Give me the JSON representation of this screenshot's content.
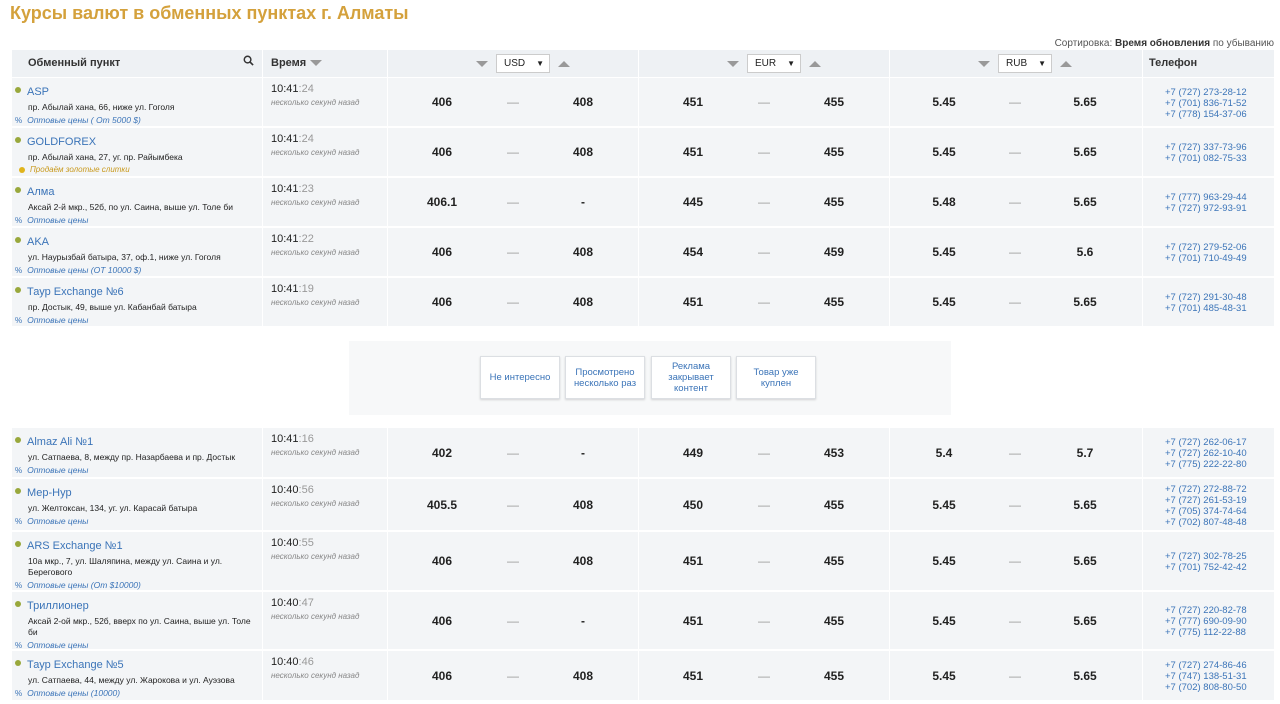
{
  "page_title": "Курсы валют в обменных пунктах г. Алматы",
  "sort": {
    "prefix": "Сортировка:",
    "field": "Время обновления",
    "order": "по убыванию"
  },
  "header": {
    "name_label": "Обменный пункт",
    "time_label": "Время",
    "currencies": [
      "USD",
      "EUR",
      "RUB"
    ],
    "phone_label": "Телефон"
  },
  "rows_top": [
    {
      "name": "ASP",
      "addr": "пр. Абылай хана, 66, ниже ул. Гоголя",
      "whole": "Оптовые цены ( От 5000 $)",
      "time": "10:41",
      "sec": ":24",
      "ago": "несколько секунд назад",
      "usd_buy": "406",
      "usd_sell": "408",
      "eur_buy": "451",
      "eur_sell": "455",
      "rub_buy": "5.45",
      "rub_sell": "5.65",
      "phones": [
        "+7 (727) 273-28-12",
        "+7 (701) 836-71-52",
        "+7 (778) 154-37-06"
      ]
    },
    {
      "name": "GOLDFOREX",
      "addr": "пр. Абылай хана, 27, уг. пр. Райымбека",
      "gold": "Продаём золотые слитки",
      "time": "10:41",
      "sec": ":24",
      "ago": "несколько секунд назад",
      "usd_buy": "406",
      "usd_sell": "408",
      "eur_buy": "451",
      "eur_sell": "455",
      "rub_buy": "5.45",
      "rub_sell": "5.65",
      "phones": [
        "+7 (727) 337-73-96",
        "+7 (701) 082-75-33"
      ]
    },
    {
      "name": "Алма",
      "addr": "Аксай 2-й мкр., 52б, по ул. Саина, выше ул. Толе би",
      "whole": "Оптовые цены",
      "time": "10:41",
      "sec": ":23",
      "ago": "несколько секунд назад",
      "usd_buy": "406.1",
      "usd_sell": "-",
      "eur_buy": "445",
      "eur_sell": "455",
      "rub_buy": "5.48",
      "rub_sell": "5.65",
      "phones": [
        "+7 (777) 963-29-44",
        "+7 (727) 972-93-91"
      ]
    },
    {
      "name": "AKA",
      "addr": "ул. Наурызбай батыра, 37, оф.1, ниже ул. Гоголя",
      "whole": "Оптовые цены (ОТ 10000 $)",
      "time": "10:41",
      "sec": ":22",
      "ago": "несколько секунд назад",
      "usd_buy": "406",
      "usd_sell": "408",
      "eur_buy": "454",
      "eur_sell": "459",
      "rub_buy": "5.45",
      "rub_sell": "5.6",
      "phones": [
        "+7 (727) 279-52-06",
        "+7 (701) 710-49-49"
      ]
    },
    {
      "name": "Таур Exchange №6",
      "addr": "пр. Достык, 49, выше ул. Кабанбай батыра",
      "whole": "Оптовые цены",
      "time": "10:41",
      "sec": ":19",
      "ago": "несколько секунд назад",
      "usd_buy": "406",
      "usd_sell": "408",
      "eur_buy": "451",
      "eur_sell": "455",
      "rub_buy": "5.45",
      "rub_sell": "5.65",
      "phones": [
        "+7 (727) 291-30-48",
        "+7 (701) 485-48-31"
      ]
    }
  ],
  "ad_feedback": [
    "Не интересно",
    "Просмотрено несколько раз",
    "Реклама закрывает контент",
    "Товар уже куплен"
  ],
  "rows_bottom": [
    {
      "name": "Almaz Ali №1",
      "addr": "ул. Сатпаева, 8, между пр. Назарбаева и пр. Достык",
      "whole": "Оптовые цены",
      "time": "10:41",
      "sec": ":16",
      "ago": "несколько секунд назад",
      "usd_buy": "402",
      "usd_sell": "-",
      "eur_buy": "449",
      "eur_sell": "453",
      "rub_buy": "5.4",
      "rub_sell": "5.7",
      "phones": [
        "+7 (727) 262-06-17",
        "+7 (727) 262-10-40",
        "+7 (775) 222-22-80"
      ]
    },
    {
      "name": "Мер-Нур",
      "addr": "ул. Желтоксан, 134, уг. ул. Карасай батыра",
      "whole": "Оптовые цены",
      "time": "10:40",
      "sec": ":56",
      "ago": "несколько секунд назад",
      "usd_buy": "405.5",
      "usd_sell": "408",
      "eur_buy": "450",
      "eur_sell": "455",
      "rub_buy": "5.45",
      "rub_sell": "5.65",
      "phones": [
        "+7 (727) 272-88-72",
        "+7 (727) 261-53-19",
        "+7 (705) 374-74-64",
        "+7 (702) 807-48-48"
      ]
    },
    {
      "name": "ARS Exchange №1",
      "addr": "10а мкр., 7, ул. Шаляпина, между ул. Саина и ул. Берегового",
      "whole": "Оптовые цены (От $10000)",
      "time": "10:40",
      "sec": ":55",
      "ago": "несколько секунд назад",
      "usd_buy": "406",
      "usd_sell": "408",
      "eur_buy": "451",
      "eur_sell": "455",
      "rub_buy": "5.45",
      "rub_sell": "5.65",
      "phones": [
        "+7 (727) 302-78-25",
        "+7 (701) 752-42-42"
      ]
    },
    {
      "name": "Триллионер",
      "addr": "Аксай 2-ой мкр., 52б, вверх по ул. Саина, выше ул. Толе би",
      "whole": "Оптовые цены",
      "time": "10:40",
      "sec": ":47",
      "ago": "несколько секунд назад",
      "usd_buy": "406",
      "usd_sell": "-",
      "eur_buy": "451",
      "eur_sell": "455",
      "rub_buy": "5.45",
      "rub_sell": "5.65",
      "phones": [
        "+7 (727) 220-82-78",
        "+7 (777) 690-09-90",
        "+7 (775) 112-22-88"
      ]
    },
    {
      "name": "Таур Exchange №5",
      "addr": "ул. Сатпаева, 44, между ул. Жарокова и ул. Ауэзова",
      "whole": "Оптовые цены (10000)",
      "time": "10:40",
      "sec": ":46",
      "ago": "несколько секунд назад",
      "usd_buy": "406",
      "usd_sell": "408",
      "eur_buy": "451",
      "eur_sell": "455",
      "rub_buy": "5.45",
      "rub_sell": "5.65",
      "phones": [
        "+7 (727) 274-86-46",
        "+7 (747) 138-51-31",
        "+7 (702) 808-80-50"
      ]
    }
  ]
}
